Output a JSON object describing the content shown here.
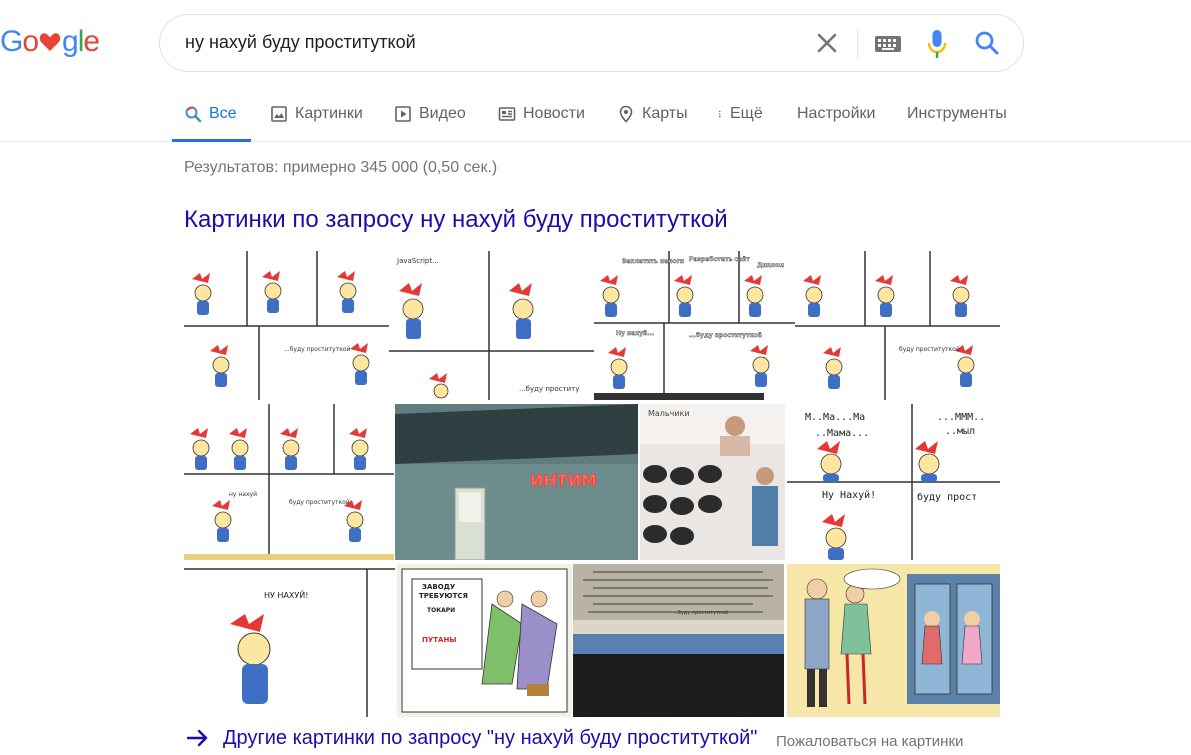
{
  "logo": {
    "letters": [
      "G",
      "o",
      "",
      "g",
      "l",
      "e"
    ],
    "colors": [
      "#4285f4",
      "#ea4335",
      "#ea4335",
      "#4285f4",
      "#34a853",
      "#ea4335"
    ]
  },
  "search": {
    "query": "ну нахуй буду проституткой"
  },
  "tabs": [
    {
      "label": "Все",
      "icon": "search-icon"
    },
    {
      "label": "Картинки",
      "icon": "image-icon"
    },
    {
      "label": "Видео",
      "icon": "video-icon"
    },
    {
      "label": "Новости",
      "icon": "news-icon"
    },
    {
      "label": "Карты",
      "icon": "map-pin-icon"
    },
    {
      "label": "Ещё",
      "icon": "more-vert-icon"
    },
    {
      "label": "Настройки",
      "icon": ""
    },
    {
      "label": "Инструменты",
      "icon": ""
    }
  ],
  "results": {
    "stats": "Результатов: примерно 345 000 (0,50 сек.)",
    "images_heading": "Картинки по запросу ну нахуй буду проституткой",
    "thumb_texts": {
      "t1": "...буду проституткой",
      "t2_top": "JavaScript...",
      "t2_bottom": "...буду проститу",
      "t3_a": "Заплатить налоги",
      "t3_b": "Разработать сайт",
      "t3_c": "Диплом",
      "t3_d": "Ну нахуй...",
      "t3_e": "...буду проституткой",
      "t4": "буду проституткой",
      "t5_a": "ну нахуй",
      "t5_b": "буду проституткой",
      "t6": "ИНТИМ",
      "t7": "Мальчики",
      "t8_a": "М..Ма...Ма",
      "t8_b": "..Мама...",
      "t8_c": "...МММ..",
      "t8_d": "..мыл",
      "t8_e": "Ну Нахуй!",
      "t8_f": "буду прост",
      "t9": "НУ НАХУЙ!",
      "t10_a": "ЗАВОДУ",
      "t10_b": "ТРЕБУЮТСЯ",
      "t10_c": "ТОКАРИ",
      "t10_d": "ПУТАНЫ",
      "t11": "...буду проституткой"
    }
  },
  "more_images_link": "Другие картинки по запросу \"ну нахуй буду проституткой\"",
  "report_link": "Пожаловаться на картинки"
}
